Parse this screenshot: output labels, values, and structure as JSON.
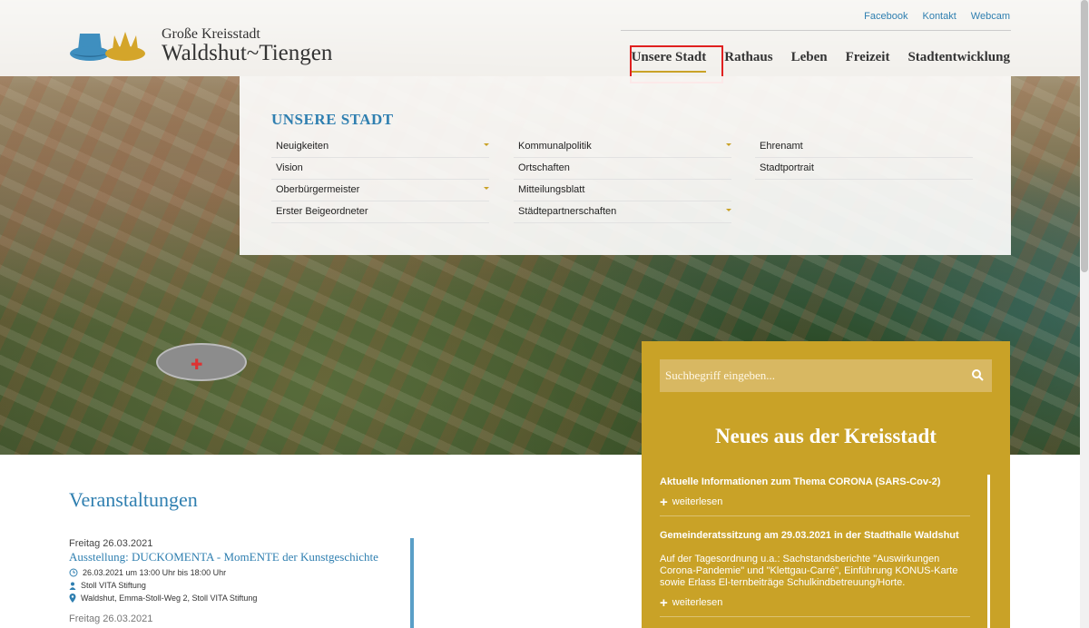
{
  "top_links": [
    "Facebook",
    "Kontakt",
    "Webcam"
  ],
  "logo": {
    "line1": "Große Kreisstadt",
    "line2": "Waldshut~Tiengen"
  },
  "nav": [
    "Unsere Stadt",
    "Rathaus",
    "Leben",
    "Freizeit",
    "Stadtentwicklung"
  ],
  "mega": {
    "title": "UNSERE STADT",
    "col1": [
      {
        "label": "Neuigkeiten",
        "sub": true
      },
      {
        "label": "Vision",
        "sub": false
      },
      {
        "label": "Oberbürgermeister",
        "sub": true
      },
      {
        "label": "Erster Beigeordneter",
        "sub": false
      }
    ],
    "col2": [
      {
        "label": "Kommunalpolitik",
        "sub": true
      },
      {
        "label": "Ortschaften",
        "sub": false
      },
      {
        "label": "Mitteilungsblatt",
        "sub": false
      },
      {
        "label": "Städtepartnerschaften",
        "sub": true
      }
    ],
    "col3": [
      {
        "label": "Ehrenamt",
        "sub": false
      },
      {
        "label": "Stadtportrait",
        "sub": false
      }
    ]
  },
  "search": {
    "placeholder": "Suchbegriff eingeben..."
  },
  "news": {
    "title": "Neues aus der Kreisstadt",
    "more_label": "weiterlesen",
    "items": [
      {
        "title": "Aktuelle Informationen zum Thema CORONA (SARS-Cov-2)",
        "text": ""
      },
      {
        "title": "Gemeinderatssitzung am 29.03.2021 in der Stadthalle Waldshut",
        "text": "Auf der Tagesordnung u.a.: Sachstandsberichte \"Auswirkungen Corona-Pandemie\" und \"Klettgau-Carré\", Einführung KONUS-Karte sowie Erlass El-ternbeiträge Schulkindbetreuung/Horte."
      }
    ]
  },
  "events": {
    "title": "Veranstaltungen",
    "items": [
      {
        "date": "Freitag 26.03.2021",
        "title": "Ausstellung: DUCKOMENTA - MomENTE der Kunstgeschichte",
        "time": "26.03.2021 um 13:00 Uhr bis 18:00 Uhr",
        "organizer": "Stoll VITA Stiftung",
        "location": "Waldshut, Emma-Stoll-Weg 2, Stoll VITA Stiftung"
      }
    ],
    "next_date": "Freitag 26.03.2021"
  },
  "colors": {
    "brand_blue": "#2f7fb0",
    "brand_gold": "#c9a227",
    "highlight_red": "#e02020"
  }
}
